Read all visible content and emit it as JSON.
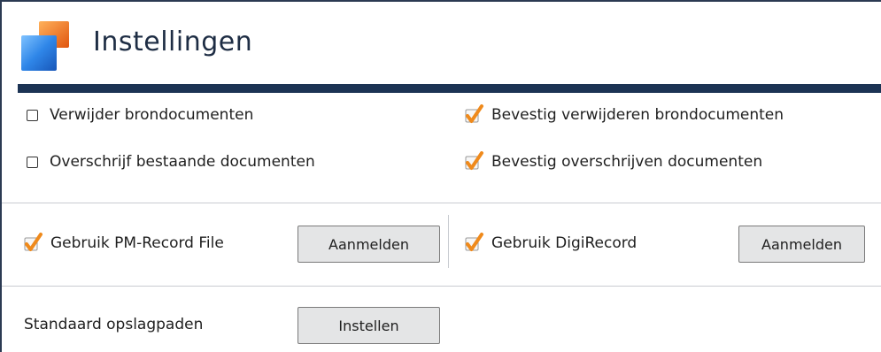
{
  "header": {
    "title": "Instellingen"
  },
  "options": {
    "delete_source": {
      "label": "Verwijder brondocumenten",
      "checked": false
    },
    "confirm_delete_source": {
      "label": "Bevestig verwijderen brondocumenten",
      "checked": true
    },
    "overwrite_existing": {
      "label": "Overschrijf bestaande documenten",
      "checked": false
    },
    "confirm_overwrite": {
      "label": "Bevestig overschrijven documenten",
      "checked": true
    }
  },
  "integrations": {
    "pm_record": {
      "label": "Gebruik PM-Record File",
      "checked": true,
      "button_label": "Aanmelden"
    },
    "digirecord": {
      "label": "Gebruik DigiRecord",
      "checked": true,
      "button_label": "Aanmelden"
    }
  },
  "storage": {
    "label": "Standaard opslagpaden",
    "button_label": "Instellen"
  },
  "colors": {
    "header_bar": "#1c3354",
    "check_orange": "#ef8a1c",
    "button_bg": "#e4e5e6"
  }
}
